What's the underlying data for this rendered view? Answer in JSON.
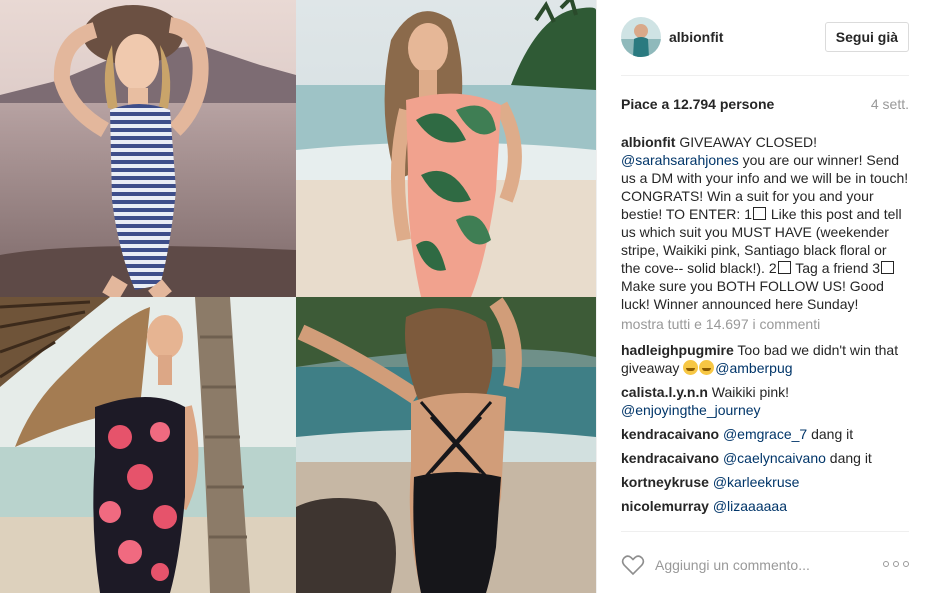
{
  "post": {
    "username": "albionfit",
    "follow_label": "Segui già",
    "likes": "Piace a 12.794 persone",
    "time": "4 sett."
  },
  "caption": {
    "author": "albionfit",
    "part1": " GIVEAWAY CLOSED! ",
    "mention": "@sarahsarahjones",
    "part2": " you are our winner! Send us a DM with your info and we will be in touch! CONGRATS! Win a suit for you and your bestie! TO ENTER: 1",
    "part3": " Like this post and tell us which suit you MUST HAVE (weekender stripe, Waikiki pink, Santiago black floral or the cove-- solid black!). 2",
    "part4": " Tag a friend 3",
    "part5": " Make sure you BOTH FOLLOW US! Good luck! Winner announced here Sunday!"
  },
  "view_all": "mostra tutti e 14.697 i commenti",
  "comments": [
    {
      "author": "hadleighpugmire",
      "text": " Too bad we didn't win that giveaway ",
      "mention": "@amberpug"
    },
    {
      "author": "calista.l.y.n.n",
      "text": " Waikiki pink! ",
      "mention": "@enjoyingthe_journey"
    },
    {
      "author": "kendracaivano",
      "mention": "@emgrace_7",
      "text_after": " dang it"
    },
    {
      "author": "kendracaivano",
      "mention": "@caelyncaivano",
      "text_after": " dang it"
    },
    {
      "author": "kortneykruse",
      "mention": "@karleekruse"
    },
    {
      "author": "nicolemurray",
      "mention": "@lizaaaaaa"
    }
  ],
  "footer": {
    "comment_placeholder": "Aggiungi un commento..."
  },
  "colors": {
    "link": "#003569",
    "muted": "#999999",
    "text": "#262626",
    "border": "#efefef"
  }
}
